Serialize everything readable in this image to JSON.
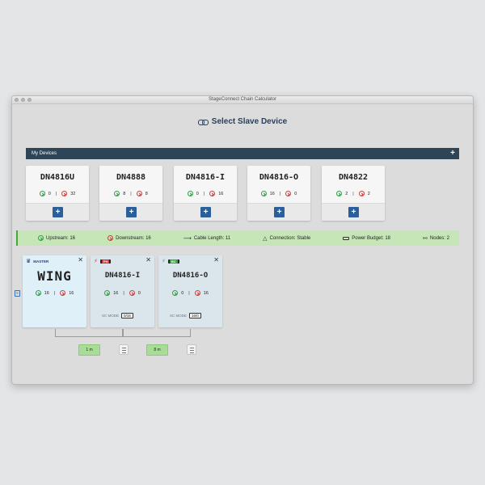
{
  "window": {
    "title": "StageConnect Chain Calculator"
  },
  "heading": {
    "title": "Select Slave Device",
    "icon": "link-icon"
  },
  "devices_bar": {
    "label": "My Devices",
    "add_label": "+"
  },
  "devices": [
    {
      "name": "DN4816U",
      "in": "0",
      "out": "32",
      "add": "+"
    },
    {
      "name": "DN4888",
      "in": "8",
      "out": "8",
      "add": "+"
    },
    {
      "name": "DN4816-I",
      "in": "0",
      "out": "16",
      "add": "+"
    },
    {
      "name": "DN4816-O",
      "in": "16",
      "out": "0",
      "add": "+"
    },
    {
      "name": "DN4822",
      "in": "2",
      "out": "2",
      "add": "+"
    }
  ],
  "status": {
    "upstream": "Upstream: 16",
    "downstream": "Downstream: 16",
    "cable": "Cable Length: 11",
    "connection": "Connection: Stable",
    "power": "Power Budget: 18",
    "nodes": "Nodes: 2"
  },
  "chain": {
    "side_glyph": "≡",
    "master": {
      "badge": "MASTER",
      "name": "WING",
      "in": "16",
      "out": "16",
      "close": "✕"
    },
    "slaves": [
      {
        "name": "DN4816-I",
        "tag": "PH",
        "in": "16",
        "out": "0",
        "scmode_label": "SC MODE",
        "scmode": "0/16",
        "close": "✕"
      },
      {
        "name": "DN4816-O",
        "tag": "BC",
        "in": "0",
        "out": "16",
        "scmode_label": "SC MODE",
        "scmode": "16/0",
        "close": "✕"
      }
    ],
    "cables": [
      {
        "label": "1 m"
      },
      {
        "label": "8 m"
      }
    ]
  },
  "colors": {
    "accent": "#2d4557",
    "status_bg": "#c6e6b7",
    "add_button": "#2b5f9b",
    "cable_button": "#a9dc96"
  }
}
